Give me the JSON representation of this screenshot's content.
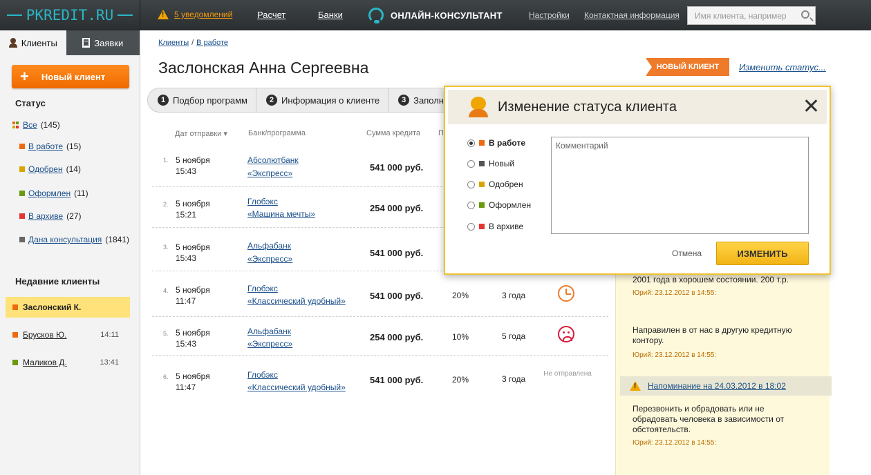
{
  "header": {
    "logo": "PKREDIT.RU",
    "notifications": "5 уведомлений",
    "nav": [
      "Расчет",
      "Банки"
    ],
    "consultant": "ОНЛАЙН-КОНСУЛЬТАНТ",
    "links": [
      "Настройки",
      "Контактная информация"
    ],
    "search_placeholder": "Имя клиента, например"
  },
  "sidebar": {
    "tabs": [
      "Клиенты",
      "Заявки"
    ],
    "new_client": "Новый клиент",
    "status_heading": "Статус",
    "statuses": [
      {
        "label": "Все",
        "count": "(145)",
        "color": "multi"
      },
      {
        "label": "В работе",
        "count": "(15)",
        "color": "#ee6a10"
      },
      {
        "label": "Одобрен",
        "count": "(14)",
        "color": "#d9a400"
      },
      {
        "label": "Оформлен",
        "count": "(11)",
        "color": "#6a9a10"
      },
      {
        "label": "В архиве",
        "count": "(27)",
        "color": "#e53434"
      },
      {
        "label": "Дана консультация",
        "count": "(1841)",
        "color": "#666666"
      }
    ],
    "recent_heading": "Недавние клиенты",
    "recent": [
      {
        "name": "Заслонский К.",
        "time": "",
        "color": "#ee6a10"
      },
      {
        "name": "Брусков Ю.",
        "time": "14:11",
        "color": "#ee6a10"
      },
      {
        "name": "Маликов Д.",
        "time": "13:41",
        "color": "#6a9a10"
      }
    ]
  },
  "main": {
    "breadcrumbs": [
      "Клиенты",
      "В работе"
    ],
    "title": "Заслонская Анна Сергеевна",
    "status_badge": "НОВЫЙ КЛИЕНТ",
    "change_status_link": "Изменить статус...",
    "tabs": [
      {
        "num": "1",
        "label": "Подбор программ"
      },
      {
        "num": "2",
        "label": "Информация о клиенте"
      },
      {
        "num": "3",
        "label": "Заполнен"
      }
    ],
    "columns": [
      "Дат отправки ▾",
      "Банк/программа",
      "Сумма кредита",
      "П"
    ],
    "rows": [
      {
        "n": "1.",
        "date": "5 ноября",
        "time": "15:43",
        "bank": "Абсолютбанк",
        "prog": "«Экспресс»",
        "amount": "541 000 руб.",
        "rate": "",
        "term": "",
        "icon": "",
        "note": ""
      },
      {
        "n": "2.",
        "date": "5 ноября",
        "time": "15:21",
        "bank": "Глобэкс",
        "prog": "«Машина мечты»",
        "amount": "254 000 руб.",
        "rate": "",
        "term": "",
        "icon": "",
        "note": ""
      },
      {
        "n": "3.",
        "date": "5 ноября",
        "time": "15:43",
        "bank": "Альфабанк",
        "prog": "«Экспресс»",
        "amount": "541 000 руб.",
        "rate": "",
        "term": "",
        "icon": "",
        "note": ""
      },
      {
        "n": "4.",
        "date": "5 ноября",
        "time": "11:47",
        "bank": "Глобэкс",
        "prog": "«Классический удобный»",
        "amount": "541 000 руб.",
        "rate": "20%",
        "term": "3 года",
        "icon": "clock",
        "note": ""
      },
      {
        "n": "5.",
        "date": "5 ноября",
        "time": "15:43",
        "bank": "Альфабанк",
        "prog": "«Экспресс»",
        "amount": "254 000 руб.",
        "rate": "10%",
        "term": "5 года",
        "icon": "sad",
        "note": ""
      },
      {
        "n": "6.",
        "date": "5 ноября",
        "time": "11:47",
        "bank": "Глобэкс",
        "prog": "«Классический удобный»",
        "amount": "541 000 руб.",
        "rate": "20%",
        "term": "3 года",
        "icon": "",
        "note": "Не отправлена"
      }
    ]
  },
  "notes": {
    "items": [
      {
        "text": "2001 года в хорошем состоянии. 200 т.р.",
        "meta": "Юрий: 23.12.2012 в 14:55:"
      },
      {
        "text": "Направилен в от нас в другую кредитную контору.",
        "meta": "Юрий: 23.12.2012 в 14:55:"
      },
      {
        "text": "Перезвонить и обрадовать или не обрадовать человека в зависимости от обстоятельств.",
        "meta": "Юрий: 23.12.2012 в 14:55:"
      }
    ],
    "reminder": "Напоминание на 24.03.2012 в 18:02"
  },
  "modal": {
    "title": "Изменение статуса клиента",
    "options": [
      {
        "label": "В работе",
        "color": "#ee6a10",
        "selected": true
      },
      {
        "label": "Новый",
        "color": "#555555",
        "selected": false
      },
      {
        "label": "Одобрен",
        "color": "#d9a400",
        "selected": false
      },
      {
        "label": "Оформлен",
        "color": "#6a9a10",
        "selected": false
      },
      {
        "label": "В архиве",
        "color": "#e53434",
        "selected": false
      }
    ],
    "comment_placeholder": "Комментарий",
    "cancel": "Отмена",
    "submit": "ИЗМЕНИТЬ"
  }
}
